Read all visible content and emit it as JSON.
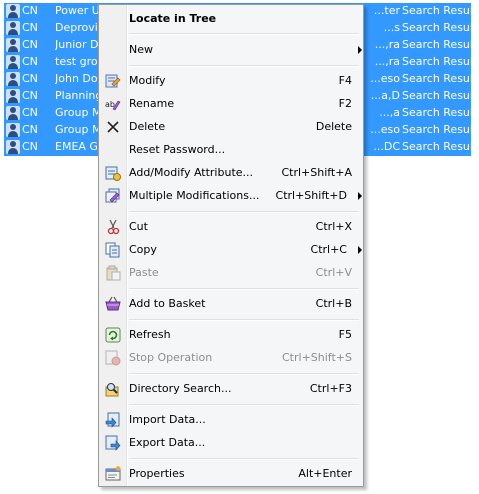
{
  "results": {
    "rows": [
      {
        "type": "CN",
        "name": "Power Us",
        "dn": "ter...",
        "source": "Search Result"
      },
      {
        "type": "CN",
        "name": "Deprovis",
        "dn": "s...",
        "source": "Search Result"
      },
      {
        "type": "CN",
        "name": "Junior De",
        "dn": "ra,...",
        "source": "Search Result"
      },
      {
        "type": "CN",
        "name": "test grou",
        "dn": "ra,...",
        "source": "Search Result"
      },
      {
        "type": "CN",
        "name": "John Dor",
        "dn": "eso...",
        "source": "Search Result"
      },
      {
        "type": "CN",
        "name": "Planning",
        "dn": "a,D...",
        "source": "Search Result"
      },
      {
        "type": "CN",
        "name": "Group Ma",
        "dn": "a,...",
        "source": "Search Result"
      },
      {
        "type": "CN",
        "name": "Group Ma",
        "dn": "eso...",
        "source": "Search Result"
      },
      {
        "type": "CN",
        "name": "EMEA Gro",
        "dn": "DC...",
        "source": "Search Result"
      }
    ]
  },
  "menu": {
    "items": [
      {
        "label": "Locate in Tree",
        "shortcut": "",
        "bold": true
      },
      {
        "label": "New",
        "shortcut": "",
        "submenu": true
      },
      {
        "label": "Modify",
        "shortcut": "F4",
        "icon": "modify-icon"
      },
      {
        "label": "Rename",
        "shortcut": "F2",
        "icon": "rename-icon"
      },
      {
        "label": "Delete",
        "shortcut": "Delete",
        "icon": "delete-icon"
      },
      {
        "label": "Reset Password...",
        "shortcut": "",
        "icon": "reset-password-icon"
      },
      {
        "label": "Add/Modify Attribute...",
        "shortcut": "Ctrl+Shift+A",
        "icon": "add-attribute-icon"
      },
      {
        "label": "Multiple Modifications...",
        "shortcut": "Ctrl+Shift+D",
        "submenu": true,
        "icon": "multiple-modifications-icon"
      },
      {
        "label": "Cut",
        "shortcut": "Ctrl+X",
        "icon": "cut-icon"
      },
      {
        "label": "Copy",
        "shortcut": "Ctrl+C",
        "submenu": true,
        "icon": "copy-icon"
      },
      {
        "label": "Paste",
        "shortcut": "Ctrl+V",
        "disabled": true,
        "icon": "paste-icon"
      },
      {
        "label": "Add to Basket",
        "shortcut": "Ctrl+B",
        "icon": "basket-icon"
      },
      {
        "label": "Refresh",
        "shortcut": "F5",
        "icon": "refresh-icon"
      },
      {
        "label": "Stop Operation",
        "shortcut": "Ctrl+Shift+S",
        "disabled": true,
        "icon": "stop-icon"
      },
      {
        "label": "Directory Search...",
        "shortcut": "Ctrl+F3",
        "icon": "directory-search-icon"
      },
      {
        "label": "Import Data...",
        "shortcut": "",
        "icon": "import-icon"
      },
      {
        "label": "Export Data...",
        "shortcut": "",
        "icon": "export-icon"
      },
      {
        "label": "Properties",
        "shortcut": "Alt+Enter",
        "icon": "properties-icon"
      }
    ]
  },
  "colors": {
    "selection": "#3399ff",
    "menu_bg": "#f5f6f7",
    "disabled_text": "#8d8d8d"
  }
}
